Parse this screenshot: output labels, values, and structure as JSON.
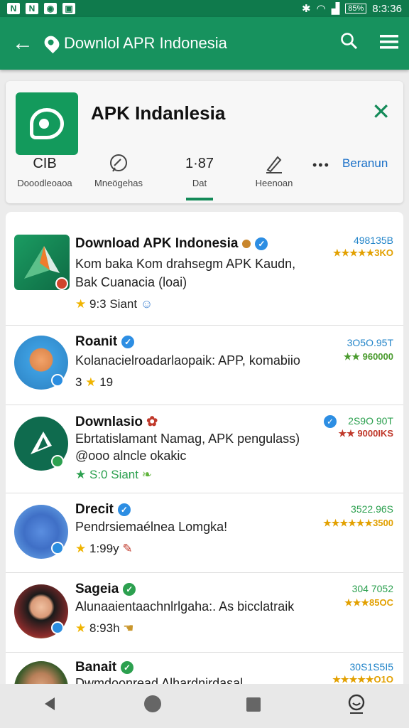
{
  "status": {
    "time": "8:3:36",
    "battery": "85%"
  },
  "appbar": {
    "title": "Downlol APR Indonesia"
  },
  "header": {
    "app_name": "APK Indanlesia",
    "stats": [
      {
        "value": "CIB",
        "label": "Dooodleoaoa"
      },
      {
        "value": "",
        "label": "Mneögehas"
      },
      {
        "value": "1·87",
        "label": "Dat"
      },
      {
        "value": "",
        "label": "Heenoan"
      }
    ],
    "more_label": "Beranun"
  },
  "list": [
    {
      "title": "Download APK Indonesia",
      "desc1": "Kom baka Kom drahsegm APK Kaudn,",
      "desc2": "Bak Cuanacia (loai)",
      "rating": "9:3 Siant",
      "num": "498135B",
      "sub": "★★★★★3KO"
    },
    {
      "title": "Roanit",
      "desc1": "Kolanacielroadarlaopaik: APP, komabiio",
      "desc2": "",
      "rating": "19",
      "rating_prefix": "3",
      "num": "3O5O.95T",
      "sub": "★★ 960000"
    },
    {
      "title": "Downlasio",
      "desc1": "Ebrtatislamant Namag, APK pengulass)",
      "desc2": "@ooo alncle okakic",
      "rating": "S:0 Siant",
      "num": "2S9O 90T",
      "sub": "★★ 9000IKS"
    },
    {
      "title": "Drecit",
      "desc1": "Pendrsiemaélnea Lomgka!",
      "desc2": "",
      "rating": "1:99y",
      "num": "3522.96S",
      "sub": "★★★★★★3500"
    },
    {
      "title": "Sageia",
      "desc1": "Alunaaientaachnlrlgaha:. As bicclatraik",
      "desc2": "",
      "rating": "8:93h",
      "num": "304 7052",
      "sub": "★★★85OC"
    },
    {
      "title": "Banait",
      "desc1": "Dwmdoonread Alhardnirdasal",
      "desc2": "",
      "rating": "",
      "num": "30S1S5I5",
      "sub": "★★★★★O1O"
    }
  ]
}
